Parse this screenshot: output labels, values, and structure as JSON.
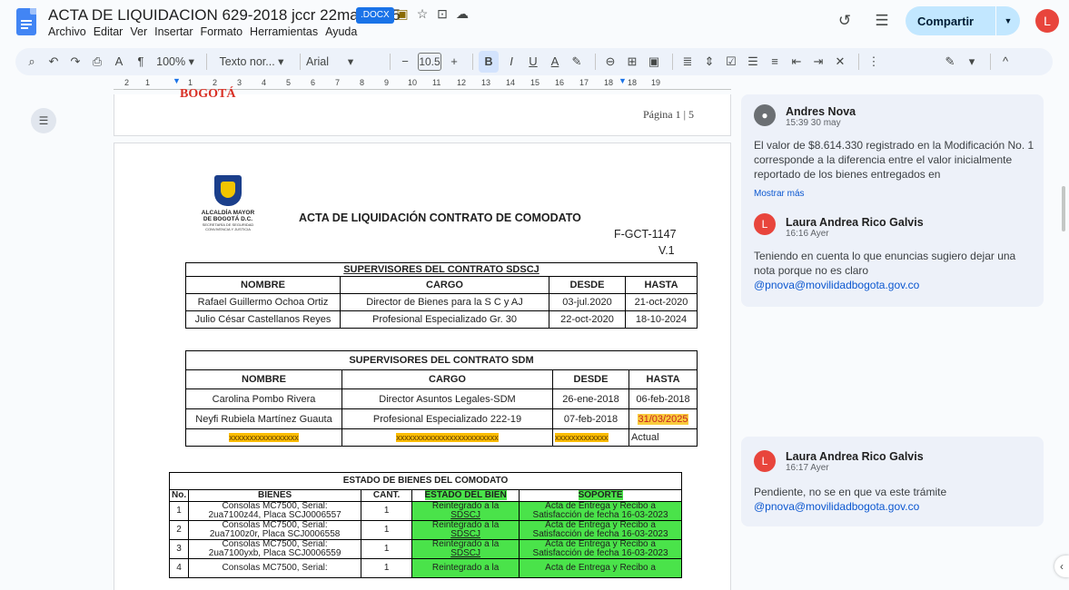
{
  "doc": {
    "title": "ACTA DE LIQUIDACION 629-2018 jccr 22may2025",
    "badge": ".DOCX",
    "menu": [
      "Archivo",
      "Editar",
      "Ver",
      "Insertar",
      "Formato",
      "Herramientas",
      "Ayuda"
    ],
    "share_label": "Compartir",
    "user_initial": "L"
  },
  "toolbar": {
    "zoom": "100%",
    "style": "Texto nor...",
    "font": "Arial",
    "font_size": "10.5",
    "icons": [
      "search-icon",
      "undo-icon",
      "redo-icon",
      "print-icon",
      "spellcheck-icon",
      "paint-format-icon",
      "bold-icon",
      "italic-icon",
      "underline-icon",
      "text-color-icon",
      "highlight-icon",
      "link-icon",
      "comment-icon",
      "image-icon",
      "align-icon",
      "line-spacing-icon",
      "checklist-icon",
      "bullet-list-icon",
      "numbered-list-icon",
      "indent-decrease-icon",
      "indent-increase-icon",
      "clear-format-icon",
      "more-icon",
      "edit-mode-icon",
      "collapse-icon"
    ]
  },
  "ruler": {
    "ticks": [
      "2",
      "1",
      "1",
      "2",
      "3",
      "4",
      "5",
      "6",
      "7",
      "8",
      "9",
      "10",
      "11",
      "12",
      "13",
      "14",
      "15",
      "16",
      "17",
      "18",
      "19"
    ]
  },
  "page_prev": {
    "stamp": "BOGOTÁ",
    "page_label": "Página 1 | 5"
  },
  "page": {
    "crest_line1": "ALCALDÍA MAYOR",
    "crest_line2": "DE BOGOTÁ D.C.",
    "crest_line3": "SECRETARÍA DE SEGURIDAD",
    "crest_line4": "CONVIVENCIA Y JUSTICIA",
    "title": "ACTA DE LIQUIDACIÓN CONTRATO DE COMODATO",
    "code": "F-GCT-1147",
    "version": "V.1"
  },
  "table_sdscj": {
    "caption": "SUPERVISORES DEL CONTRATO  SDSCJ",
    "headers": [
      "NOMBRE",
      "CARGO",
      "DESDE",
      "HASTA"
    ],
    "rows": [
      [
        "Rafael Guillermo Ochoa Ortiz",
        "Director de Bienes para la S C y AJ",
        "03-jul.2020",
        "21-oct-2020"
      ],
      [
        "Julio César Castellanos Reyes",
        "Profesional Especializado Gr. 30",
        "22-oct-2020",
        "18-10-2024"
      ]
    ]
  },
  "table_sdm": {
    "caption": "SUPERVISORES DEL CONTRATO  SDM",
    "headers": [
      "NOMBRE",
      "CARGO",
      "DESDE",
      "HASTA"
    ],
    "rows": [
      [
        "Carolina Pombo Rivera",
        "Director Asuntos Legales-SDM",
        "26-ene-2018",
        "06-feb-2018"
      ],
      [
        "Neyfi Rubiela Martínez Guauta",
        "Profesional Especializado 222-19",
        "07-feb-2018",
        "31/03/2025"
      ],
      [
        "xxxxxxxxxxxxxxxxx",
        "xxxxxxxxxxxxxxxxxxxxxxxxx",
        "xxxxxxxxxxxxx",
        "Actual"
      ]
    ]
  },
  "table_bienes": {
    "caption": "ESTADO DE BIENES DEL COMODATO",
    "headers": [
      "No.",
      "BIENES",
      "CANT.",
      "ESTADO DEL BIEN",
      "SOPORTE"
    ],
    "rows": [
      [
        "1",
        "Consolas MC7500, Serial:",
        "2ua7100z44, Placa SCJ0006557",
        "1",
        "Reintegrado a la",
        "SDSCJ",
        "Acta de Entrega y Recibo a",
        "Satisfacción de fecha 16-03-2023"
      ],
      [
        "2",
        "Consolas MC7500, Serial:",
        "2ua7100z0r, Placa SCJ0006558",
        "1",
        "Reintegrado a la",
        "SDSCJ",
        "Acta de Entrega y Recibo a",
        "Satisfacción de fecha 16-03-2023"
      ],
      [
        "3",
        "Consolas MC7500, Serial:",
        "2ua7100yxb, Placa SCJ0006559",
        "1",
        "Reintegrado a la",
        "SDSCJ",
        "Acta de Entrega y Recibo a",
        "Satisfacción de fecha 16-03-2023"
      ],
      [
        "4",
        "Consolas MC7500, Serial:",
        "",
        "1",
        "Reintegrado a la",
        "",
        "Acta de Entrega y Recibo a",
        ""
      ]
    ]
  },
  "comments": [
    {
      "author": "Andres Nova",
      "time": "15:39 30 may",
      "text": "El valor de $8.614.330 registrado en la Modificación No. 1 corresponde a la diferencia entre el valor inicialmente reportado de los bienes entregados en",
      "more": "Mostrar más",
      "reply_initial": "L",
      "reply_author": "Laura Andrea Rico Galvis",
      "reply_time": "16:16 Ayer",
      "reply_text": "Teniendo en cuenta lo que enuncias sugiero dejar una nota porque no es claro",
      "reply_mention": "@pnova@movilidadbogota.gov.co"
    },
    {
      "initial": "L",
      "author": "Laura Andrea Rico Galvis",
      "time": "16:17 Ayer",
      "text": "Pendiente, no se en que va este trámite",
      "mention": "@pnova@movilidadbogota.gov.co"
    }
  ]
}
